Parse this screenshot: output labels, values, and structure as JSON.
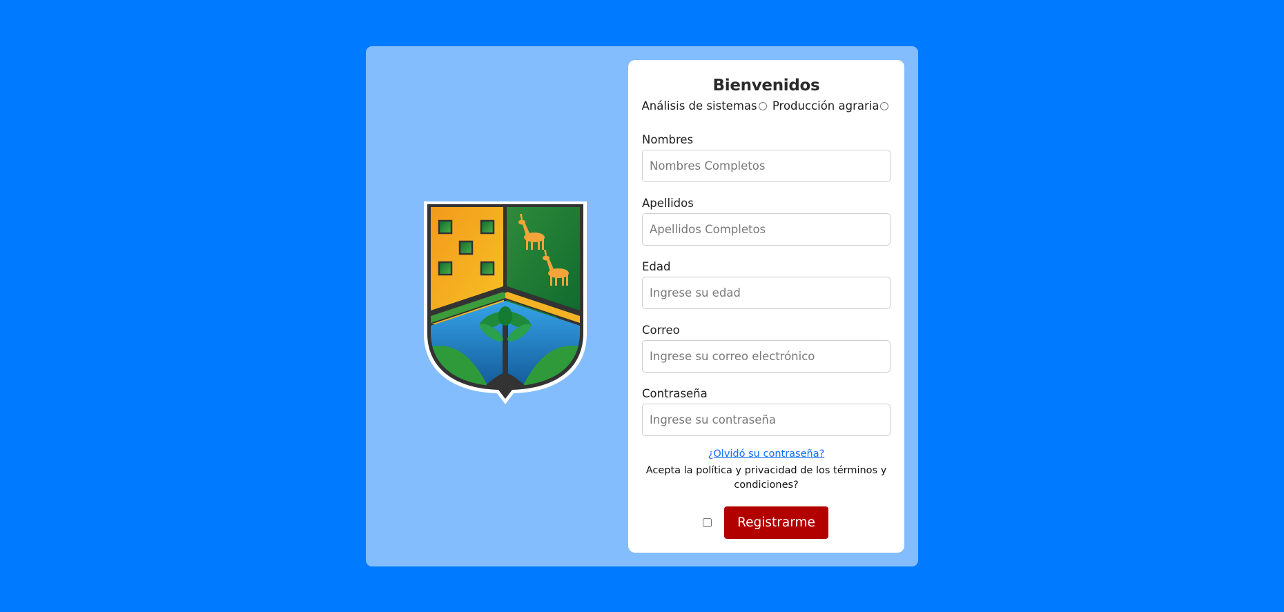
{
  "colors": {
    "page_background": "#007bff",
    "panel_background": "#83bdfd",
    "card_background": "#ffffff",
    "submit_button": "#b20000",
    "link": "#0d6efd"
  },
  "logo": {
    "icon": "university-coat-of-arms-icon"
  },
  "form": {
    "title": "Bienvenidos",
    "programs": [
      {
        "label": "Análisis de sistemas",
        "selected": false
      },
      {
        "label": "Producción agraria",
        "selected": false
      }
    ],
    "fields": {
      "nombres": {
        "label": "Nombres",
        "placeholder": "Nombres Completos",
        "value": ""
      },
      "apellidos": {
        "label": "Apellidos",
        "placeholder": "Apellidos Completos",
        "value": ""
      },
      "edad": {
        "label": "Edad",
        "placeholder": "Ingrese su edad",
        "value": ""
      },
      "correo": {
        "label": "Correo",
        "placeholder": "Ingrese su correo electrónico",
        "value": ""
      },
      "contrasena": {
        "label": "Contraseña",
        "placeholder": "Ingrese su contraseña",
        "value": ""
      }
    },
    "forgot_link": "¿Olvidó su contraseña?",
    "terms_text": "Acepta la política y privacidad de los términos y condiciones?",
    "terms_checked": false,
    "submit_label": "Registrarme"
  }
}
